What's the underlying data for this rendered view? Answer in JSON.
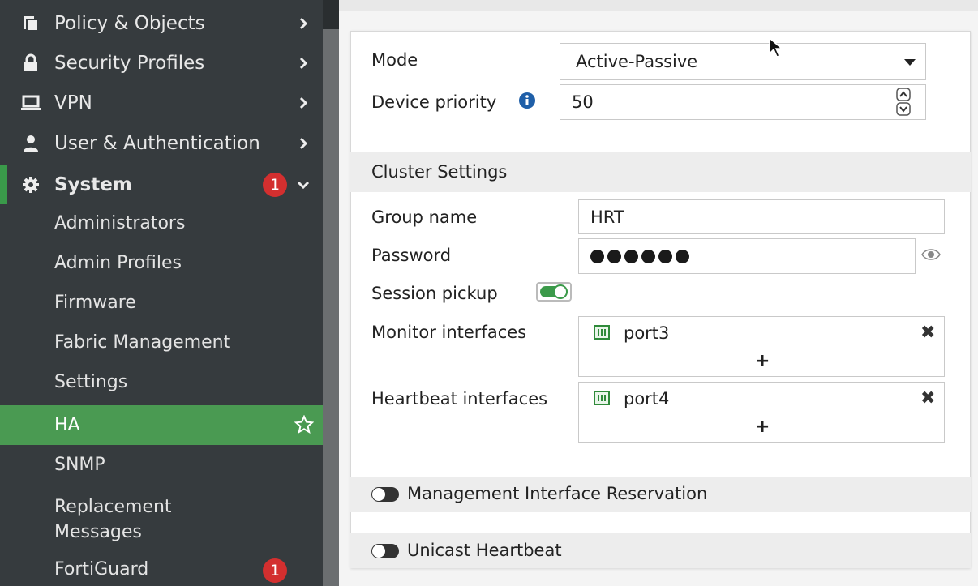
{
  "sidebar": {
    "top_items": [
      {
        "label": "Policy & Objects",
        "icon": "policy-icon"
      },
      {
        "label": "Security Profiles",
        "icon": "lock-icon"
      },
      {
        "label": "VPN",
        "icon": "monitor-icon"
      },
      {
        "label": "User & Authentication",
        "icon": "user-icon"
      }
    ],
    "system": {
      "label": "System",
      "badge": "1",
      "icon": "gear-icon"
    },
    "sub_items": [
      {
        "label": "Administrators"
      },
      {
        "label": "Admin Profiles"
      },
      {
        "label": "Firmware"
      },
      {
        "label": "Fabric Management"
      },
      {
        "label": "Settings"
      },
      {
        "label": "HA"
      },
      {
        "label": "SNMP"
      },
      {
        "label": "Replacement Messages"
      },
      {
        "label": "FortiGuard",
        "badge": "1"
      }
    ]
  },
  "form": {
    "mode_label": "Mode",
    "mode_value": "Active-Passive",
    "priority_label": "Device priority",
    "priority_value": "50",
    "cluster_header": "Cluster Settings",
    "group_label": "Group name",
    "group_value": "HRT",
    "password_label": "Password",
    "session_label": "Session pickup",
    "session_pickup_on": true,
    "monitor_label": "Monitor interfaces",
    "monitor_port": "port3",
    "heartbeat_label": "Heartbeat interfaces",
    "heartbeat_port": "port4",
    "plus": "+",
    "remove": "✖",
    "mgmt_label": "Management Interface Reservation",
    "unicast_label": "Unicast Heartbeat"
  },
  "colors": {
    "sidebar_bg": "#363b3e",
    "active_green": "#4a9a52",
    "badge_red": "#d32f2f",
    "info_blue": "#1f5fa8"
  }
}
